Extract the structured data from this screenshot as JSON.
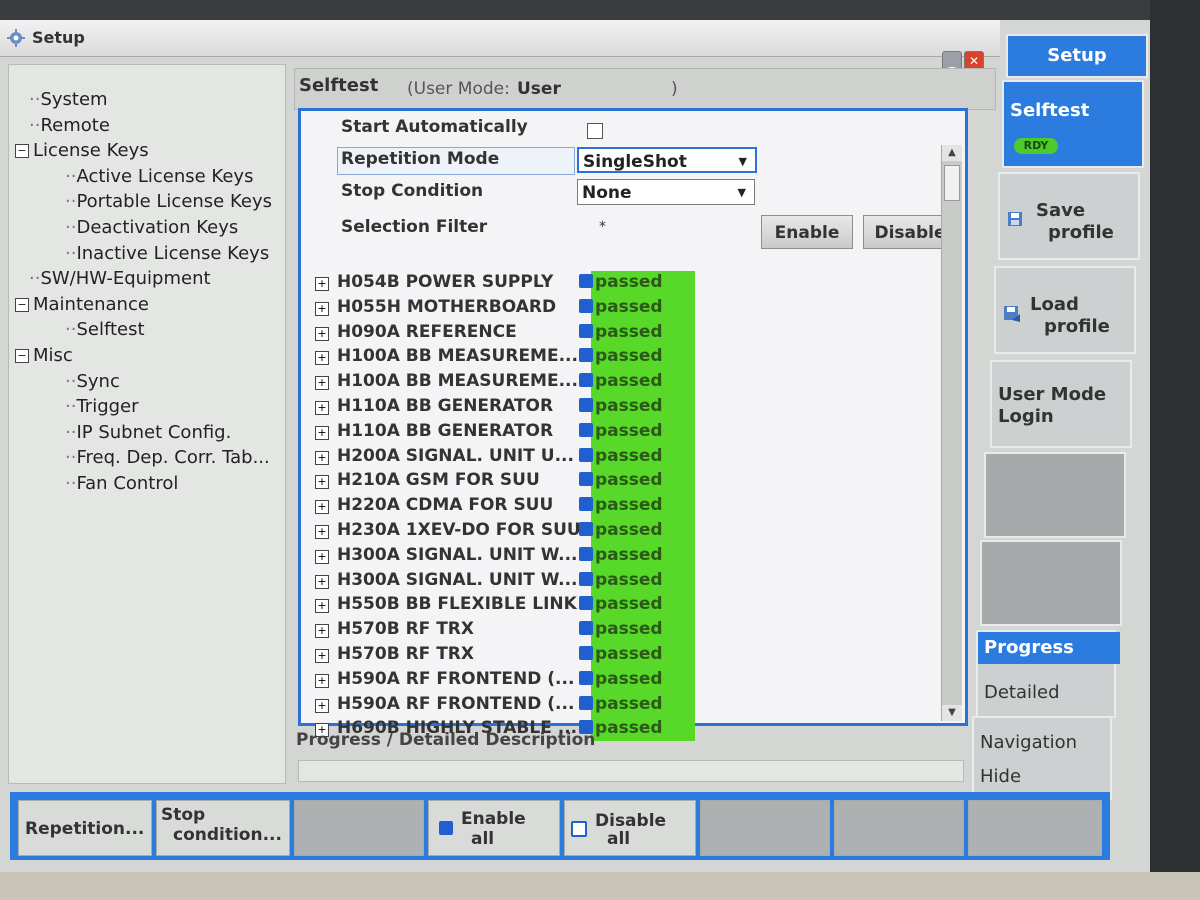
{
  "window": {
    "title": "Setup"
  },
  "tree": {
    "items": [
      {
        "label": "System",
        "level": 1,
        "expander": ""
      },
      {
        "label": "Remote",
        "level": 1,
        "expander": ""
      },
      {
        "label": "License Keys",
        "level": 0,
        "expander": "−"
      },
      {
        "label": "Active License Keys",
        "level": 2,
        "expander": ""
      },
      {
        "label": "Portable License Keys",
        "level": 2,
        "expander": ""
      },
      {
        "label": "Deactivation Keys",
        "level": 2,
        "expander": ""
      },
      {
        "label": "Inactive License Keys",
        "level": 2,
        "expander": ""
      },
      {
        "label": "SW/HW-Equipment",
        "level": 1,
        "expander": ""
      },
      {
        "label": "Maintenance",
        "level": 0,
        "expander": "−"
      },
      {
        "label": "Selftest",
        "level": 2,
        "expander": ""
      },
      {
        "label": "Misc",
        "level": 0,
        "expander": "−"
      },
      {
        "label": "Sync",
        "level": 2,
        "expander": ""
      },
      {
        "label": "Trigger",
        "level": 2,
        "expander": ""
      },
      {
        "label": "IP Subnet Config.",
        "level": 2,
        "expander": ""
      },
      {
        "label": "Freq. Dep. Corr. Tab...",
        "level": 2,
        "expander": ""
      },
      {
        "label": "Fan Control",
        "level": 2,
        "expander": ""
      }
    ]
  },
  "panel": {
    "title": "Selftest",
    "user_mode_label": "(User Mode:",
    "user_mode_value": "User",
    "user_mode_close": ")"
  },
  "settings": {
    "start_automatically": "Start Automatically",
    "repetition_mode": "Repetition Mode",
    "repetition_value": "SingleShot",
    "stop_condition": "Stop Condition",
    "stop_value": "None",
    "selection_filter": "Selection Filter",
    "filter_value": "*",
    "enable_btn": "Enable",
    "disable_btn": "Disable"
  },
  "tests": [
    {
      "name": "H054B POWER SUPPLY",
      "status": "passed"
    },
    {
      "name": "H055H MOTHERBOARD",
      "status": "passed"
    },
    {
      "name": "H090A REFERENCE",
      "status": "passed"
    },
    {
      "name": "H100A BB MEASUREME...",
      "status": "passed"
    },
    {
      "name": "H100A BB MEASUREME...",
      "status": "passed"
    },
    {
      "name": "H110A BB GENERATOR",
      "status": "passed"
    },
    {
      "name": "H110A BB GENERATOR",
      "status": "passed"
    },
    {
      "name": "H200A SIGNAL. UNIT U...",
      "status": "passed"
    },
    {
      "name": "H210A GSM FOR SUU",
      "status": "passed"
    },
    {
      "name": "H220A CDMA FOR SUU",
      "status": "passed"
    },
    {
      "name": "H230A 1XEV-DO FOR SUU",
      "status": "passed"
    },
    {
      "name": "H300A SIGNAL. UNIT W...",
      "status": "passed"
    },
    {
      "name": "H300A SIGNAL. UNIT W...",
      "status": "passed"
    },
    {
      "name": "H550B BB FLEXIBLE LINK",
      "status": "passed"
    },
    {
      "name": "H570B RF TRX",
      "status": "passed"
    },
    {
      "name": "H570B RF TRX",
      "status": "passed"
    },
    {
      "name": "H590A RF FRONTEND (...",
      "status": "passed"
    },
    {
      "name": "H590A RF FRONTEND (...",
      "status": "passed"
    },
    {
      "name": "H690B HIGHLY STABLE ...",
      "status": "passed"
    }
  ],
  "progress": {
    "label": "Progress / Detailed Description"
  },
  "softkeys": {
    "setup": "Setup",
    "selftest": "Selftest",
    "rdy": "RDY",
    "save_line1": "Save",
    "save_line2": "profile",
    "load_line1": "Load",
    "load_line2": "profile",
    "usermode_line1": "User Mode",
    "usermode_line2": "Login",
    "progress": "Progress",
    "detailed": "Detailed",
    "navigation": "Navigation",
    "hide": "Hide"
  },
  "bottom": {
    "repetition": "Repetition...",
    "stop_line1": "Stop",
    "stop_line2": "condition...",
    "enable_line1": "Enable",
    "enable_line2": "all",
    "disable_line1": "Disable",
    "disable_line2": "all"
  },
  "colors": {
    "accent": "#2c7ce0",
    "pass": "#58d828"
  }
}
